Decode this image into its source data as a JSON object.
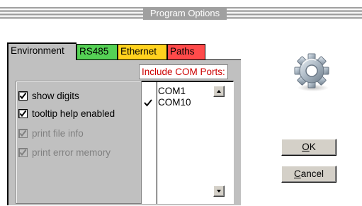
{
  "window": {
    "title": "Program Options"
  },
  "tabs": [
    {
      "label": "Environment",
      "color": "#c0c0c0",
      "active": true
    },
    {
      "label": "RS485",
      "color": "#55d155",
      "active": false
    },
    {
      "label": "Ethernet",
      "color": "#ffd21e",
      "active": false
    },
    {
      "label": "Paths",
      "color": "#ff4a4a",
      "active": false
    }
  ],
  "options": [
    {
      "label": "show digits",
      "checked": true,
      "enabled": true
    },
    {
      "label": "tooltip help enabled",
      "checked": true,
      "enabled": true
    },
    {
      "label": "print file info",
      "checked": true,
      "enabled": false
    },
    {
      "label": "print error memory",
      "checked": true,
      "enabled": false
    }
  ],
  "com_ports": {
    "label": "Include COM Ports:",
    "label_color": "#cc0000",
    "items": [
      {
        "name": "COM1",
        "included": false
      },
      {
        "name": "COM10",
        "included": true
      }
    ]
  },
  "icons": {
    "settings": "gear-icon"
  },
  "buttons": {
    "ok": "OK",
    "cancel": "Cancel"
  }
}
